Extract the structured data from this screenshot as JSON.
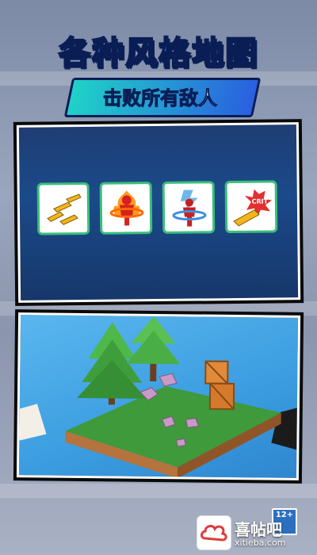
{
  "header": {
    "title": "各种风格地图",
    "subtitle": "击败所有敌人"
  },
  "skills": [
    {
      "name": "bullet-upgrade-icon"
    },
    {
      "name": "fire-ring-icon"
    },
    {
      "name": "lightning-icon"
    },
    {
      "name": "crit-bullet-icon",
      "label": "CRIT"
    }
  ],
  "badge": {
    "age": "12+"
  },
  "watermark": {
    "name": "喜帖吧",
    "url": "xitieba.com"
  },
  "colors": {
    "title": "#1a6fe0",
    "skill_border": "#3bbf7a",
    "water": "#3b9de0",
    "grass": "#3e9a3a"
  }
}
